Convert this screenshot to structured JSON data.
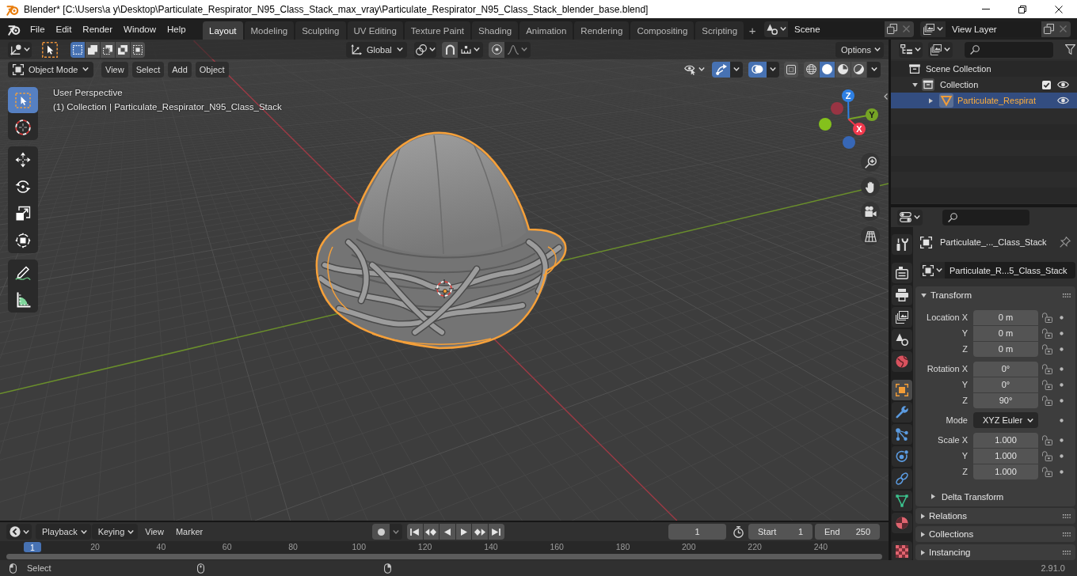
{
  "window": {
    "title": "Blender* [C:\\Users\\a y\\Desktop\\Particulate_Respirator_N95_Class_Stack_max_vray\\Particulate_Respirator_N95_Class_Stack_blender_base.blend]"
  },
  "menu": [
    "File",
    "Edit",
    "Render",
    "Window",
    "Help"
  ],
  "workspaces": [
    {
      "label": "Layout",
      "selected": true
    },
    {
      "label": "Modeling",
      "selected": false
    },
    {
      "label": "Sculpting",
      "selected": false
    },
    {
      "label": "UV Editing",
      "selected": false
    },
    {
      "label": "Texture Paint",
      "selected": false
    },
    {
      "label": "Shading",
      "selected": false
    },
    {
      "label": "Animation",
      "selected": false
    },
    {
      "label": "Rendering",
      "selected": false
    },
    {
      "label": "Compositing",
      "selected": false
    },
    {
      "label": "Scripting",
      "selected": false
    }
  ],
  "add_workspace": "+",
  "scene": "Scene",
  "view_layer": "View Layer",
  "viewport": {
    "select_modes": [
      {
        "kind": "set",
        "selected": true
      },
      {
        "kind": "extend",
        "selected": false
      },
      {
        "kind": "subtract",
        "selected": false
      },
      {
        "kind": "invert",
        "selected": false
      },
      {
        "kind": "intersect",
        "selected": false
      }
    ],
    "orientation": "Global",
    "snap": false,
    "proportional": false,
    "options": "Options",
    "mode": "Object Mode",
    "menus": [
      "View",
      "Select",
      "Add",
      "Object"
    ],
    "gizmos": true,
    "overlays": true,
    "xray": false,
    "shading": [
      {
        "kind": "wireframe",
        "selected": false
      },
      {
        "kind": "solid",
        "selected": true
      },
      {
        "kind": "material",
        "selected": false
      },
      {
        "kind": "rendered",
        "selected": false
      }
    ],
    "info": [
      "User Perspective",
      "(1) Collection | Particulate_Respirator_N95_Class_Stack"
    ],
    "tool_groups": [
      {
        "tools": [
          {
            "kind": "select_box",
            "selected": true
          },
          {
            "kind": "cursor",
            "selected": false
          }
        ]
      },
      {
        "tools": [
          {
            "kind": "move",
            "selected": false
          },
          {
            "kind": "rotate",
            "selected": false
          },
          {
            "kind": "scale",
            "selected": false
          },
          {
            "kind": "transform",
            "selected": false
          }
        ]
      },
      {
        "tools": [
          {
            "kind": "annotate",
            "selected": false
          },
          {
            "kind": "measure",
            "selected": false
          }
        ]
      }
    ],
    "axes": [
      {
        "kind": "positive",
        "label": "Z",
        "color": "#2e80e4"
      },
      {
        "kind": "positive",
        "label": "Y",
        "color": "#76a425"
      },
      {
        "kind": "positive",
        "label": "X",
        "color": "#f2394d"
      },
      {
        "kind": "negative",
        "color": "#983443"
      },
      {
        "kind": "negative",
        "color": "#84c11c"
      },
      {
        "kind": "negative",
        "color": "#3767b6"
      }
    ]
  },
  "outliner": {
    "root": "Scene Collection",
    "items": [
      {
        "kind": "collection",
        "label": "Collection",
        "expanded": true,
        "selected": false,
        "checked": true,
        "visible": true,
        "children": [
          {
            "kind": "mesh",
            "label": "Particulate_Respirat",
            "expanded": false,
            "selected": true,
            "visible": true
          }
        ]
      }
    ]
  },
  "properties": {
    "tab_groups": [
      {
        "tabs": [
          {
            "kind": "tool",
            "selected": false
          }
        ]
      },
      {
        "tabs": [
          {
            "kind": "render",
            "selected": false
          },
          {
            "kind": "output",
            "selected": false
          },
          {
            "kind": "view_layer",
            "selected": false
          },
          {
            "kind": "scene",
            "selected": false
          },
          {
            "kind": "world",
            "selected": false
          }
        ]
      },
      {
        "tabs": [
          {
            "kind": "object",
            "selected": true
          },
          {
            "kind": "modifiers",
            "selected": false
          },
          {
            "kind": "particles",
            "selected": false
          },
          {
            "kind": "physics",
            "selected": false
          },
          {
            "kind": "constraints",
            "selected": false
          },
          {
            "kind": "data",
            "selected": false
          },
          {
            "kind": "material",
            "selected": false
          }
        ]
      },
      {
        "tabs": [
          {
            "kind": "texture",
            "selected": false
          }
        ]
      }
    ],
    "object_name": "Particulate_..._Class_Stack",
    "data_block": "Particulate_R...5_Class_Stack",
    "transform": {
      "title": "Transform",
      "expanded": true,
      "groups": [
        {
          "rows": [
            {
              "kind": "number",
              "label": "Location X",
              "value": "0 m",
              "locked": false
            },
            {
              "kind": "number",
              "label": "Y",
              "value": "0 m",
              "locked": false
            },
            {
              "kind": "number",
              "label": "Z",
              "value": "0 m",
              "locked": false
            }
          ]
        },
        {
          "rows": [
            {
              "kind": "number",
              "label": "Rotation X",
              "value": "0°",
              "locked": false
            },
            {
              "kind": "number",
              "label": "Y",
              "value": "0°",
              "locked": false
            },
            {
              "kind": "number",
              "label": "Z",
              "value": "90°",
              "locked": false
            }
          ]
        },
        {
          "rows": [
            {
              "kind": "dropdown",
              "label": "Mode",
              "value": "XYZ Euler"
            }
          ]
        },
        {
          "rows": [
            {
              "kind": "number",
              "label": "Scale X",
              "value": "1.000",
              "locked": false
            },
            {
              "kind": "number",
              "label": "Y",
              "value": "1.000",
              "locked": false
            },
            {
              "kind": "number",
              "label": "Z",
              "value": "1.000",
              "locked": false
            }
          ]
        }
      ],
      "subpanels": [
        {
          "title": "Delta Transform",
          "expanded": false
        }
      ]
    },
    "panels": [
      {
        "title": "Relations",
        "expanded": false
      },
      {
        "title": "Collections",
        "expanded": false
      },
      {
        "title": "Instancing",
        "expanded": false
      }
    ]
  },
  "timeline": {
    "menus": [
      {
        "kind": "dropdown",
        "label": "Playback"
      },
      {
        "kind": "dropdown",
        "label": "Keying"
      },
      {
        "kind": "menu",
        "label": "View"
      },
      {
        "kind": "menu",
        "label": "Marker"
      }
    ],
    "auto_keying": false,
    "current_frame": "1",
    "start": {
      "label": "Start",
      "value": "1"
    },
    "end": {
      "label": "End",
      "value": "250"
    },
    "playhead": "1",
    "ticks": [
      "20",
      "40",
      "60",
      "80",
      "100",
      "120",
      "140",
      "160",
      "180",
      "200",
      "220",
      "240"
    ]
  },
  "status_bar": {
    "hint": "Select",
    "version": "2.91.0"
  }
}
